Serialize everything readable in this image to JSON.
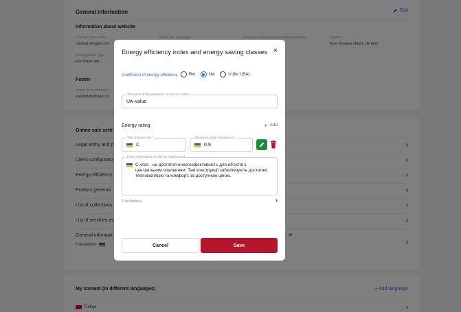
{
  "general": {
    "title": "General information",
    "edit_label": "Edit",
    "info_subtitle": "Information about website",
    "fields": [
      {
        "label": "Domain site name",
        "value": "manual.vitrager.com"
      },
      {
        "label": "Main site language",
        "value": ""
      },
      {
        "label": "Email to receive partnership requests",
        "value": ""
      },
      {
        "label": "Region",
        "value": "Kyiv, Kyivska oblast, Ukraine"
      }
    ],
    "configurator_type_label": "Configurator type",
    "configurator_type_value": "For online sell",
    "footer_title": "Footer",
    "footer_email_label": "Email for customer's",
    "footer_email_value": "support@vitrager.co"
  },
  "online": {
    "title": "Online sale setti",
    "rows": [
      "Legal entity and p",
      "Client configurato",
      "Energy efficiency",
      "Product generati",
      "List of collections",
      "List of services av",
      "General informati"
    ],
    "general_row_extra": "ar",
    "translations_label": "Translations:"
  },
  "content": {
    "title": "My content (in different languages)",
    "add_language": "+ Add language",
    "language": "Türkçe"
  },
  "modal": {
    "title": "Energy efficiency index and energy saving classes",
    "close": "×",
    "coef_label": "Coefficient of energy efficiency",
    "radio_options": [
      "Rw",
      "Uw",
      "U (for USA)"
    ],
    "selected_radio": "Uw",
    "param_name_label": "The name of the parameter on the microsite *",
    "param_name_value": "Uw-value",
    "rating_title": "Energy rating",
    "rating_add": "Add",
    "title_label": "Title (Українська) *",
    "title_value": "C",
    "max_label": "Maximum value (Українська...",
    "max_value": "0.9",
    "desc_label": "Enter a description for the tip (Українська)",
    "desc_value": "С клас - це достатня енергоефективність для об'єктів з центральним опаленням. Такі конструкції забезпечують достатню теплоізоляцію та комфорт, за доступною ціною.",
    "translations_label": "Translations",
    "cancel": "Cancel",
    "save": "Save"
  },
  "colors": {
    "accent_blue": "#2e6be6",
    "brand_red": "#b5162e",
    "edit_green": "#1a8f3c"
  }
}
